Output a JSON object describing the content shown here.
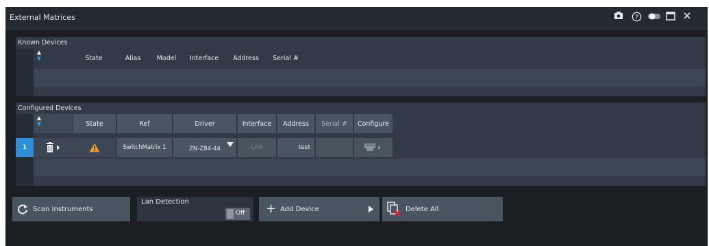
{
  "window": {
    "title": "External Matrices"
  },
  "titlebar_icons": [
    "camera-icon",
    "help-icon",
    "toggle-icon",
    "maximize-icon",
    "close-icon"
  ],
  "known_devices": {
    "title": "Known Devices",
    "columns": [
      "State",
      "Alias",
      "Model",
      "Interface",
      "Address",
      "Serial #"
    ]
  },
  "configured_devices": {
    "title": "Configured Devices",
    "columns": [
      "State",
      "Ref",
      "Driver",
      "Interface",
      "Address",
      "Serial #",
      "Configure"
    ],
    "rows": [
      {
        "index": "1",
        "ref": "SwitchMatrix 1",
        "driver": "ZN-Z84-44",
        "interface": "LAN",
        "address": "test",
        "serial": ""
      }
    ]
  },
  "toolbar": {
    "scan_label": "Scan Instruments",
    "lan_detection_label": "Lan Detection",
    "lan_detection_value": "Off",
    "add_device_label": "Add Device",
    "delete_all_label": "Delete All"
  },
  "colors": {
    "accent": "#2aa0f0",
    "warning": "#f0a020",
    "delete": "#e0262e"
  }
}
